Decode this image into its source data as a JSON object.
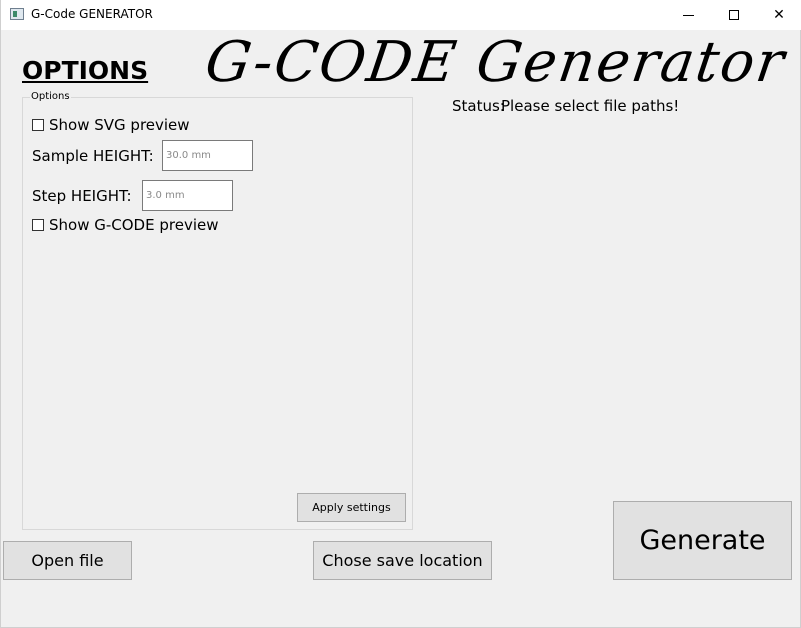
{
  "window": {
    "title": "G-Code GENERATOR",
    "minimize_glyph": "",
    "maximize_glyph": "",
    "close_glyph": "✕"
  },
  "header": {
    "options_heading": "OPTIONS",
    "app_title": "G-CODE Generator"
  },
  "options_group": {
    "legend": "Options",
    "show_svg_preview": {
      "label": "Show SVG preview",
      "checked": false
    },
    "sample_height": {
      "label": "Sample HEIGHT:",
      "value": "",
      "placeholder": "30.0 mm"
    },
    "step_height": {
      "label": "Step HEIGHT:",
      "value": "",
      "placeholder": "3.0 mm"
    },
    "show_gcode_preview": {
      "label": "Show G-CODE preview",
      "checked": false
    },
    "apply_label": "Apply settings"
  },
  "status": {
    "label": "Status:",
    "text": "Please select file paths!"
  },
  "buttons": {
    "open_file": "Open file",
    "save_location": "Chose save location",
    "generate": "Generate"
  }
}
